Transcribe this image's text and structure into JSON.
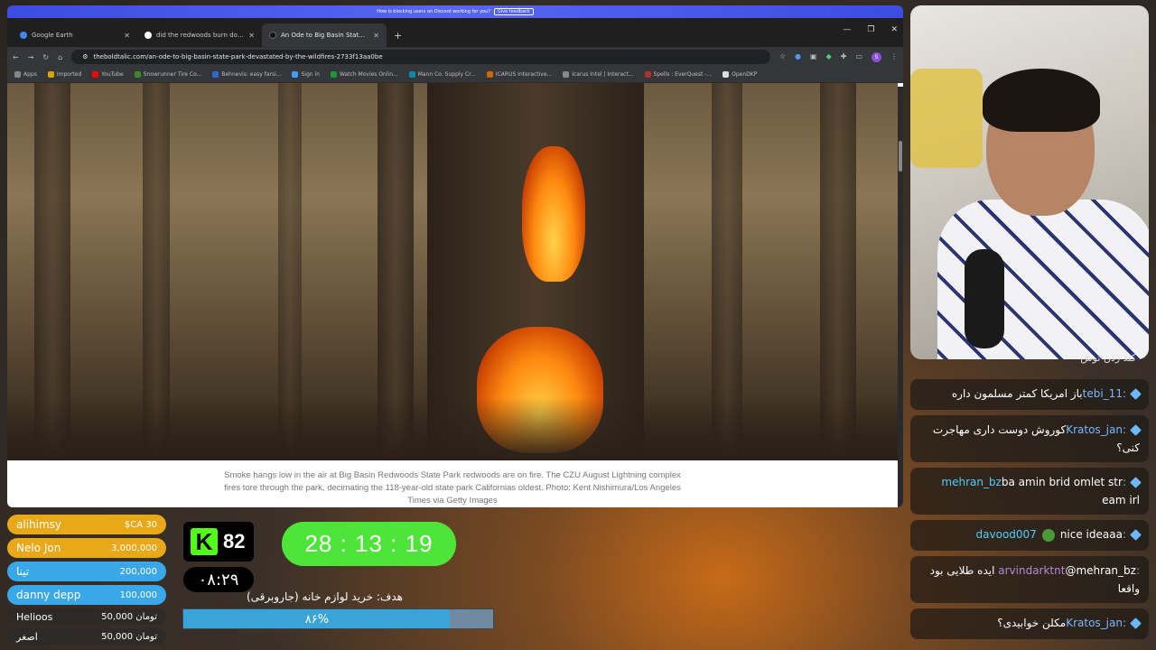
{
  "browser": {
    "banner_text": "How is blocking users on Discord working for you?",
    "banner_button": "Give feedback",
    "tabs": [
      {
        "title": "Google Earth",
        "fav_color": "#4285f4"
      },
      {
        "title": "did the redwoods burn down -",
        "fav_color": "#ffffff"
      },
      {
        "title": "An Ode to Big Basin State Park",
        "fav_color": "#111111"
      }
    ],
    "url": "theboldtalic.com/an-ode-to-big-basin-state-park-devastated-by-the-wildfires-2733f13aa0be",
    "profile_initial": "S",
    "bookmarks": [
      {
        "label": "Apps",
        "color": "#888"
      },
      {
        "label": "Imported",
        "color": "#d9a400"
      },
      {
        "label": "YouTube",
        "color": "#ff0000"
      },
      {
        "label": "Snowrunner Tire Co...",
        "color": "#3a8a2a"
      },
      {
        "label": "Behnevis: easy farsi...",
        "color": "#2a6ad8"
      },
      {
        "label": "Sign in",
        "color": "#3aa0ff"
      },
      {
        "label": "Watch Movies Onlin...",
        "color": "#1a9a3a"
      },
      {
        "label": "Mann Co. Supply Cr...",
        "color": "#0a8aa8"
      },
      {
        "label": "ICARUS Interactive...",
        "color": "#c86a00"
      },
      {
        "label": "Icarus Intel | Interact...",
        "color": "#888"
      },
      {
        "label": "Spells : EverQuest -...",
        "color": "#b03030"
      },
      {
        "label": "OpenDKP",
        "color": "#ddd"
      }
    ],
    "caption": "Smoke hangs low in the air at Big Basin Redwoods State Park redwoods are on fire. The CZU August Lightning complex fires tore through the park, decimating the 118-year-old state park Californias oldest. Photo: Kent Nishimura/Los Angeles Times via Getty Images"
  },
  "chat": {
    "top_cut": "کند ردن توش",
    "messages": [
      {
        "user": ":tebi_11",
        "text": "باز امریکا کمتر مسلمون داره",
        "user_color": "#7ab8ff"
      },
      {
        "user": ":Kratos_jan",
        "text": "کوروش دوست داری مهاجرت کنی؟",
        "user_color": "#7ab8ff"
      },
      {
        "user": ":mehran_bz",
        "text": "ba amin brid omlet str eam irl",
        "user_color": "#4ad0ff"
      },
      {
        "user": ":davood007",
        "text": "nice ideaaa",
        "user_color": "#4ad0ff"
      },
      {
        "user": ":arvindarktnt",
        "text": "@mehran_bz ایده طلایی بود واقعا",
        "user_color": "#b48ad8"
      },
      {
        "user": ":Kratos_jan",
        "text": "مکلن خوابیدی؟",
        "user_color": "#7ab8ff"
      }
    ]
  },
  "donors": [
    {
      "name": "alihimsy",
      "amount": "$CA 30",
      "color": "#e8a818"
    },
    {
      "name": "Nelo Jon",
      "amount": "3,000,000",
      "color": "#e8a818"
    },
    {
      "name": "تینا",
      "amount": "200,000",
      "color": "#3aa8e8"
    },
    {
      "name": "danny depp",
      "amount": "100,000",
      "color": "#3aa8e8"
    },
    {
      "name": "Helioos",
      "amount": "50,000 تومان",
      "color": ""
    },
    {
      "name": "اصغر",
      "amount": "50,000 تومان",
      "color": ""
    }
  ],
  "stats": {
    "kick_logo": "K",
    "kick_count": "82",
    "clock": "۰۸:۲۹",
    "timer": "28 : 13 : 19",
    "goal_label": "هدف: خرید لوازم خانه (جاروبرقی)",
    "goal_percent_text": "۸۶%",
    "goal_percent": 0.86
  }
}
